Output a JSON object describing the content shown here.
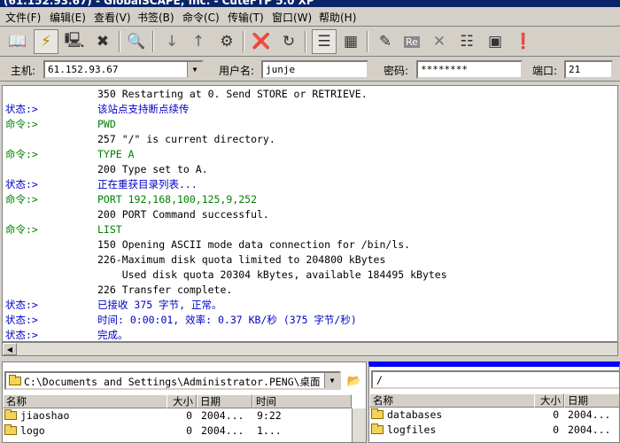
{
  "window": {
    "title": "(61.152.93.67) - GlobalSCAPE, Inc. - CuteFTP 5.0 XP"
  },
  "menu": [
    {
      "label": "文件(F)"
    },
    {
      "label": "编辑(E)"
    },
    {
      "label": "查看(V)"
    },
    {
      "label": "书签(B)"
    },
    {
      "label": "命令(C)"
    },
    {
      "label": "传输(T)"
    },
    {
      "label": "窗口(W)"
    },
    {
      "label": "帮助(H)"
    }
  ],
  "toolbar": {
    "icons": [
      "site-manager-icon",
      "quick-connect-icon",
      "connect-icon",
      "disconnect-icon",
      "search-icon",
      "download-icon",
      "upload-icon",
      "transfer-queue-icon",
      "stop-icon",
      "refresh-icon",
      "list-view-icon",
      "detail-view-icon",
      "edit-icon",
      "rename-icon",
      "delete-icon",
      "properties-icon",
      "command-icon",
      "help-icon"
    ],
    "rename_text": "Re"
  },
  "connection": {
    "host_label": "主机:",
    "host_value": "61.152.93.67",
    "user_label": "用户名:",
    "user_value": "junje",
    "password_label": "密码:",
    "password_value": "********",
    "port_label": "端口:",
    "port_value": "21"
  },
  "log": [
    {
      "tag": "",
      "type": "resp",
      "text": "350 Restarting at 0. Send STORE or RETRIEVE."
    },
    {
      "tag": "状态:>",
      "type": "status",
      "text": "该站点支持断点续传"
    },
    {
      "tag": "命令:>",
      "type": "cmd",
      "text": "PWD"
    },
    {
      "tag": "",
      "type": "resp",
      "text": "257 \"/\" is current directory."
    },
    {
      "tag": "命令:>",
      "type": "cmd",
      "text": "TYPE A"
    },
    {
      "tag": "",
      "type": "resp",
      "text": "200 Type set to A."
    },
    {
      "tag": "状态:>",
      "type": "status",
      "text": "正在重获目录列表..."
    },
    {
      "tag": "命令:>",
      "type": "cmd",
      "text": "PORT 192,168,100,125,9,252"
    },
    {
      "tag": "",
      "type": "resp",
      "text": "200 PORT Command successful."
    },
    {
      "tag": "命令:>",
      "type": "cmd",
      "text": "LIST"
    },
    {
      "tag": "",
      "type": "resp",
      "text": "150 Opening ASCII mode data connection for /bin/ls."
    },
    {
      "tag": "",
      "type": "resp",
      "text": "226-Maximum disk quota limited to 204800 kBytes"
    },
    {
      "tag": "",
      "type": "resp",
      "text": "    Used disk quota 20304 kBytes, available 184495 kBytes"
    },
    {
      "tag": "",
      "type": "resp",
      "text": "226 Transfer complete."
    },
    {
      "tag": "状态:>",
      "type": "status",
      "text": "已接收 375 字节, 正常。"
    },
    {
      "tag": "状态:>",
      "type": "status",
      "text": "时间: 0:00:01, 效率: 0.37 KB/秒 (375 字节/秒)"
    },
    {
      "tag": "状态:>",
      "type": "status",
      "text": "完成。"
    }
  ],
  "colors": {
    "status": "#0000c8",
    "cmd": "#008000",
    "resp": "#000000",
    "remote_active": "#0000ff"
  },
  "local": {
    "path": "C:\\Documents and Settings\\Administrator.PENG\\桌面",
    "columns": [
      "名称",
      "大小",
      "日期",
      "时间"
    ],
    "rows": [
      {
        "name": "jiaoshao",
        "size": "0",
        "date": "2004...",
        "time": "9:22"
      },
      {
        "name": "logo",
        "size": "0",
        "date": "2004...",
        "time": "1..."
      }
    ]
  },
  "remote": {
    "path": "/",
    "columns": [
      "名称",
      "大小",
      "日期"
    ],
    "rows": [
      {
        "name": "databases",
        "size": "0",
        "date": "2004..."
      },
      {
        "name": "logfiles",
        "size": "0",
        "date": "2004..."
      }
    ]
  }
}
